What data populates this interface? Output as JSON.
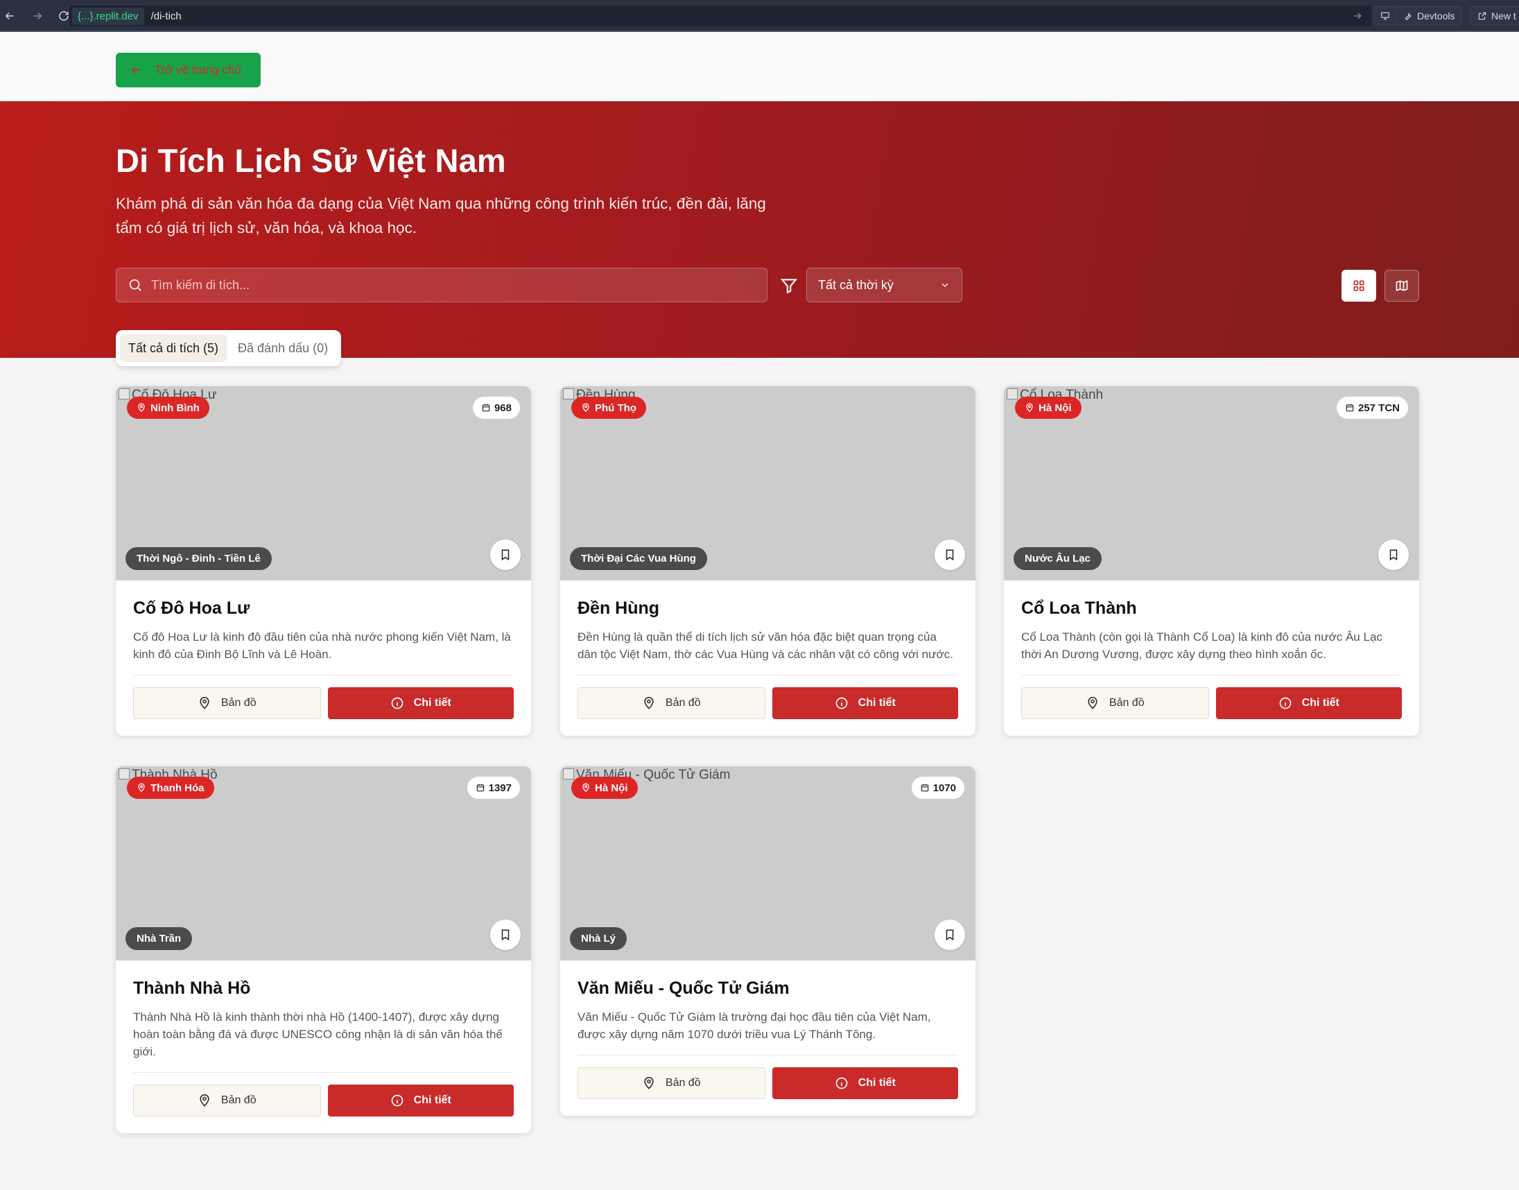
{
  "browser": {
    "domain": "{...}.replit.dev",
    "path": "/di-tich",
    "devtools_label": "Devtools",
    "newtab_label": "New t"
  },
  "back_button": {
    "label": "Trở về trang chủ"
  },
  "hero": {
    "title": "Di Tích Lịch Sử Việt Nam",
    "subtitle": "Khám phá di sản văn hóa đa dạng của Việt Nam qua những công trình kiến trúc, đền đài, lăng tẩm có giá trị lịch sử, văn hóa, và khoa học."
  },
  "search": {
    "placeholder": "Tìm kiếm di tích..."
  },
  "period_filter": {
    "selected": "Tất cả thời kỳ"
  },
  "tabs": [
    {
      "label": "Tất cả di tích (5)",
      "active": true
    },
    {
      "label": "Đã đánh dấu (0)",
      "active": false
    }
  ],
  "cards": [
    {
      "image_alt": "Cố Đô Hoa Lư",
      "location": "Ninh Bình",
      "year": "968",
      "era": "Thời Ngô - Đinh - Tiền Lê",
      "title": "Cố Đô Hoa Lư",
      "description": "Cố đô Hoa Lư là kinh đô đầu tiên của nhà nước phong kiến Việt Nam, là kinh đô của Đinh Bộ Lĩnh và Lê Hoàn.",
      "map_label": "Bản đồ",
      "detail_label": "Chi tiết"
    },
    {
      "image_alt": "Đền Hùng",
      "location": "Phú Thọ",
      "year": "",
      "era": "Thời Đại Các Vua Hùng",
      "title": "Đền Hùng",
      "description": "Đền Hùng là quần thể di tích lịch sử văn hóa đặc biệt quan trọng của dân tộc Việt Nam, thờ các Vua Hùng và các nhân vật có công với nước.",
      "map_label": "Bản đồ",
      "detail_label": "Chi tiết"
    },
    {
      "image_alt": "Cổ Loa Thành",
      "location": "Hà Nội",
      "year": "257 TCN",
      "era": "Nước Âu Lạc",
      "title": "Cổ Loa Thành",
      "description": "Cổ Loa Thành (còn gọi là Thành Cổ Loa) là kinh đô của nước Âu Lạc thời An Dương Vương, được xây dựng theo hình xoắn ốc.",
      "map_label": "Bản đồ",
      "detail_label": "Chi tiết"
    },
    {
      "image_alt": "Thành Nhà Hồ",
      "location": "Thanh Hóa",
      "year": "1397",
      "era": "Nhà Trần",
      "title": "Thành Nhà Hồ",
      "description": "Thành Nhà Hồ là kinh thành thời nhà Hồ (1400-1407), được xây dựng hoàn toàn bằng đá và được UNESCO công nhận là di sản văn hóa thế giới.",
      "map_label": "Bản đồ",
      "detail_label": "Chi tiết"
    },
    {
      "image_alt": "Văn Miếu - Quốc Tử Giám",
      "location": "Hà Nội",
      "year": "1070",
      "era": "Nhà Lý",
      "title": "Văn Miếu - Quốc Tử Giám",
      "description": "Văn Miếu - Quốc Tử Giám là trường đại học đầu tiên của Việt Nam, được xây dựng năm 1070 dưới triều vua Lý Thánh Tông.",
      "map_label": "Bản đồ",
      "detail_label": "Chi tiết"
    }
  ]
}
